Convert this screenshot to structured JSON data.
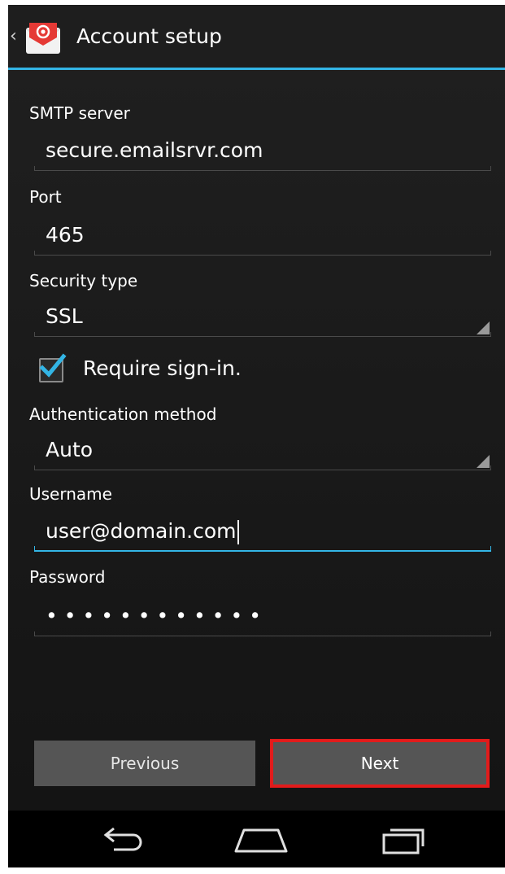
{
  "action_bar": {
    "title": "Account setup",
    "icon": "email-app-icon"
  },
  "form": {
    "smtp_label": "SMTP server",
    "smtp_value": "secure.emailsrvr.com",
    "port_label": "Port",
    "port_value": "465",
    "security_label": "Security type",
    "security_value": "SSL",
    "require_signin_label": "Require sign-in.",
    "require_signin_checked": true,
    "auth_label": "Authentication method",
    "auth_value": "Auto",
    "username_label": "Username",
    "username_value": "user@domain.com",
    "password_label": "Password",
    "password_value": "••••••••••••"
  },
  "buttons": {
    "previous": "Previous",
    "next": "Next"
  },
  "nav": {
    "back": "back-icon",
    "home": "home-icon",
    "recents": "recent-apps-icon"
  },
  "colors": {
    "accent": "#33b5e5",
    "highlight": "#e21b1b",
    "button_bg": "#555555"
  }
}
